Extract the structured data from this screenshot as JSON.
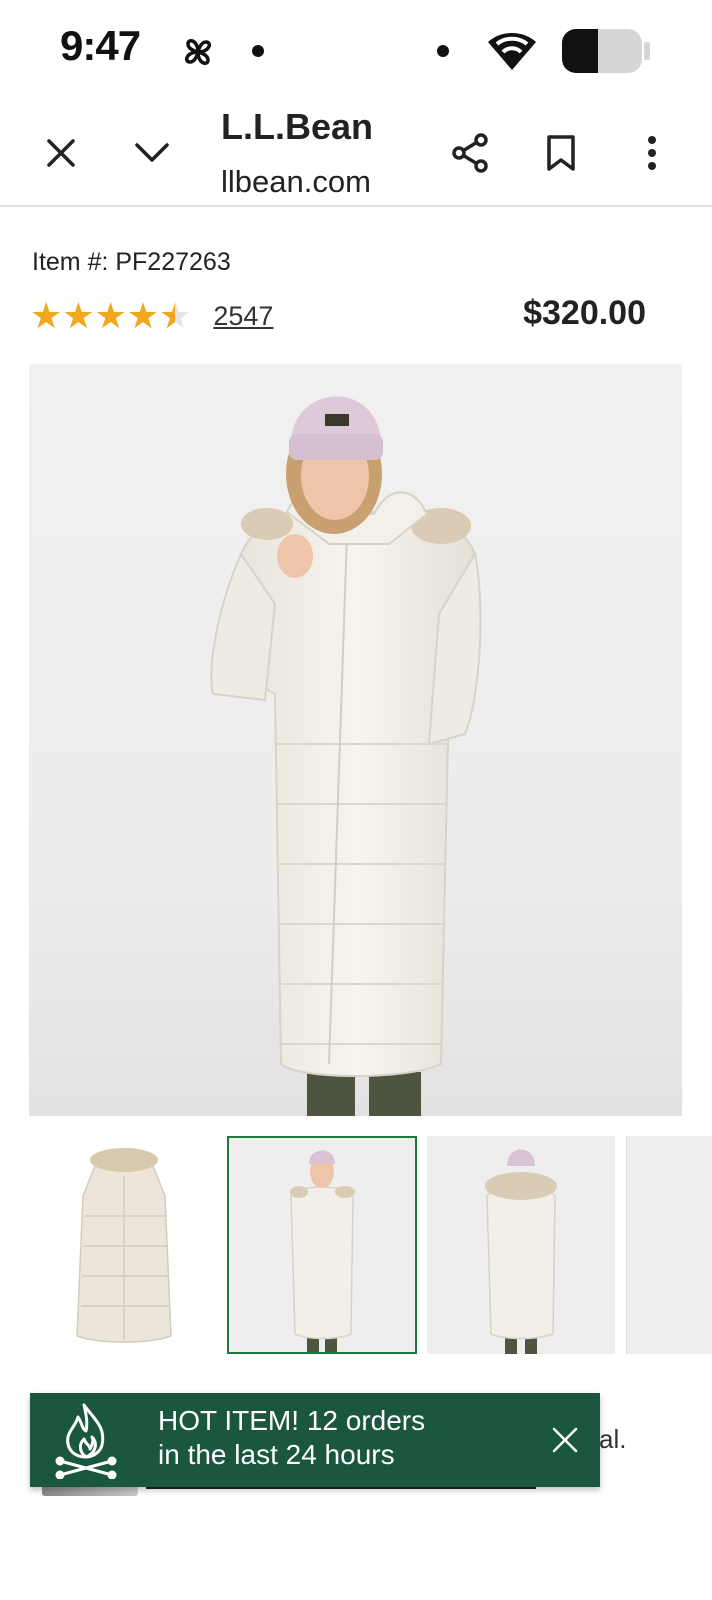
{
  "status_bar": {
    "time": "9:47",
    "battery_level": 0.45
  },
  "browser": {
    "title": "L.L.Bean",
    "url": "llbean.com",
    "icons": [
      "close-icon",
      "chevron-down-icon",
      "share-icon",
      "bookmark-icon",
      "more-vert-icon"
    ]
  },
  "product": {
    "item_number": "Item #: PF227263",
    "rating": 4.5,
    "stars_glyphs": "★★★★★",
    "review_count": "2547",
    "price": "$320.00",
    "selected_thumbnail": 2,
    "thumbnail_count_visible": 4
  },
  "hot_item": {
    "line1": "HOT ITEM! 12 orders",
    "line2": "in the last 24 hours",
    "icon": "campfire-icon",
    "close_icon": "close-icon"
  },
  "below_fold": {
    "partial_text": "val."
  },
  "colors": {
    "accent_green": "#1b563f",
    "selection_green": "#1e7a3c",
    "star_gold": "#f2a81d"
  }
}
